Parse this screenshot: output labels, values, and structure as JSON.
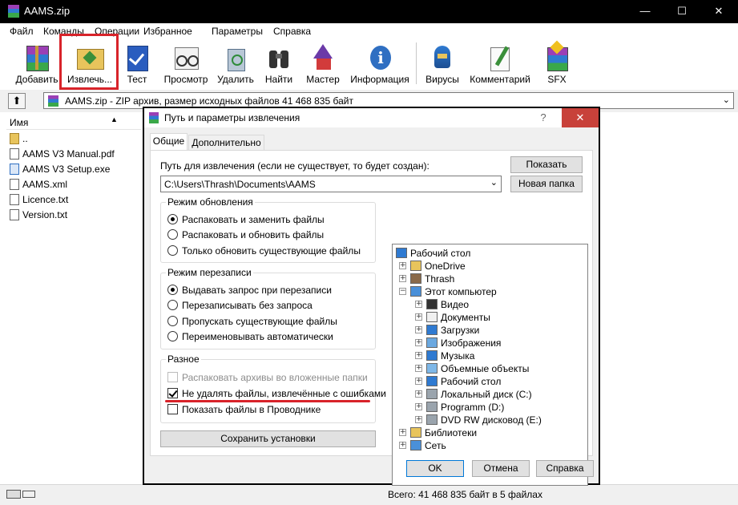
{
  "window": {
    "title": "AAMS.zip",
    "minimize": "—",
    "maximize": "☐",
    "close": "✕"
  },
  "menu": [
    "Файл",
    "Команды",
    "Операции",
    "Избранное",
    "Параметры",
    "Справка"
  ],
  "toolbar": {
    "buttons": [
      {
        "label": "Добавить",
        "icon": "archive-add-icon"
      },
      {
        "label": "Извлечь...",
        "icon": "extract-folder-icon"
      },
      {
        "label": "Тест",
        "icon": "test-check-icon"
      },
      {
        "label": "Просмотр",
        "icon": "view-glasses-icon"
      },
      {
        "label": "Удалить",
        "icon": "recycle-bin-icon"
      },
      {
        "label": "Найти",
        "icon": "find-binoculars-icon"
      },
      {
        "label": "Мастер",
        "icon": "wizard-icon"
      },
      {
        "label": "Информация",
        "icon": "info-icon"
      },
      {
        "label": "Вирусы",
        "icon": "virus-scan-icon"
      },
      {
        "label": "Комментарий",
        "icon": "comment-pen-icon"
      },
      {
        "label": "SFX",
        "icon": "sfx-archive-icon"
      }
    ]
  },
  "address": {
    "text": "AAMS.zip - ZIP архив, размер исходных файлов 41 468 835 байт"
  },
  "filelist": {
    "column_name": "Имя",
    "files": [
      {
        "name": "..",
        "icon": "folder-up-icon"
      },
      {
        "name": "AAMS V3 Manual.pdf",
        "icon": "pdf-file-icon"
      },
      {
        "name": "AAMS V3 Setup.exe",
        "icon": "exe-file-icon"
      },
      {
        "name": "AAMS.xml",
        "icon": "xml-file-icon"
      },
      {
        "name": "Licence.txt",
        "icon": "txt-file-icon"
      },
      {
        "name": "Version.txt",
        "icon": "txt-file-icon"
      }
    ]
  },
  "status": {
    "total": "Всего: 41 468 835 байт в 5 файлах"
  },
  "dialog": {
    "title": "Путь и параметры извлечения",
    "help_btn": "?",
    "close_btn": "✕",
    "tabs": [
      "Общие",
      "Дополнительно"
    ],
    "path_label": "Путь для извлечения (если не существует, то будет создан):",
    "path_value": "C:\\Users\\Thrash\\Documents\\AAMS",
    "show_button": "Показать",
    "new_folder_button": "Новая папка",
    "update_mode": {
      "title": "Режим обновления",
      "options": [
        "Распаковать и заменить файлы",
        "Распаковать и обновить файлы",
        "Только обновить существующие файлы"
      ],
      "selected": 0
    },
    "overwrite_mode": {
      "title": "Режим перезаписи",
      "options": [
        "Выдавать запрос при перезаписи",
        "Перезаписывать без запроса",
        "Пропускать существующие файлы",
        "Переименовывать автоматически"
      ],
      "selected": 0
    },
    "misc": {
      "title": "Разное",
      "options": [
        {
          "label": "Распаковать архивы во вложенные папки",
          "checked": false,
          "disabled": true
        },
        {
          "label": "Не удалять файлы, извлечённые с ошибками",
          "checked": true,
          "disabled": false
        },
        {
          "label": "Показать файлы в Проводнике",
          "checked": false,
          "disabled": false
        }
      ]
    },
    "save_settings": "Сохранить установки",
    "tree": [
      {
        "label": "Рабочий стол",
        "icon": "desktop-icon",
        "level": 0,
        "expander": ""
      },
      {
        "label": "OneDrive",
        "icon": "folder-icon",
        "level": 1,
        "expander": "+"
      },
      {
        "label": "Thrash",
        "icon": "user-icon",
        "level": 1,
        "expander": "+"
      },
      {
        "label": "Этот компьютер",
        "icon": "computer-icon",
        "level": 1,
        "expander": "−"
      },
      {
        "label": "Видео",
        "icon": "video-icon",
        "level": 2,
        "expander": "+"
      },
      {
        "label": "Документы",
        "icon": "documents-icon",
        "level": 2,
        "expander": "+"
      },
      {
        "label": "Загрузки",
        "icon": "download-icon",
        "level": 2,
        "expander": "+"
      },
      {
        "label": "Изображения",
        "icon": "pictures-icon",
        "level": 2,
        "expander": "+"
      },
      {
        "label": "Музыка",
        "icon": "music-icon",
        "level": 2,
        "expander": "+"
      },
      {
        "label": "Объемные объекты",
        "icon": "3d-objects-icon",
        "level": 2,
        "expander": "+"
      },
      {
        "label": "Рабочий стол",
        "icon": "desktop-icon",
        "level": 2,
        "expander": "+"
      },
      {
        "label": "Локальный диск (C:)",
        "icon": "drive-icon",
        "level": 2,
        "expander": "+"
      },
      {
        "label": "Programm (D:)",
        "icon": "drive-icon",
        "level": 2,
        "expander": "+"
      },
      {
        "label": "DVD RW дисковод (E:)",
        "icon": "dvd-drive-icon",
        "level": 2,
        "expander": "+"
      },
      {
        "label": "Библиотеки",
        "icon": "libraries-icon",
        "level": 1,
        "expander": "+"
      },
      {
        "label": "Сеть",
        "icon": "network-icon",
        "level": 1,
        "expander": "+"
      }
    ],
    "ok": "OK",
    "cancel": "Отмена",
    "help": "Справка"
  },
  "colors": {
    "highlight": "#d8232a",
    "accent": "#0078d7"
  }
}
